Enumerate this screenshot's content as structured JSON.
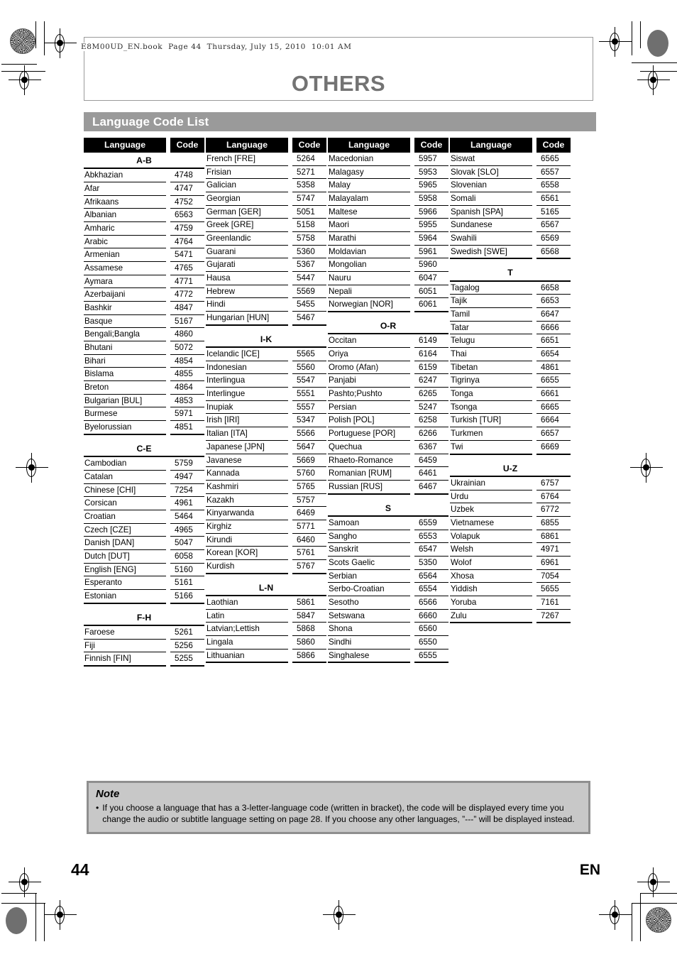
{
  "page": {
    "book_header": "E8M00UD_EN.book  Page 44  Thursday, July 15, 2010  10:01 AM",
    "chapter_title": "OTHERS",
    "section_title": "Language Code List",
    "page_number": "44",
    "page_language": "EN"
  },
  "table": {
    "header_language": "Language",
    "header_code": "Code"
  },
  "columns": [
    {
      "groups": [
        {
          "label": "A-B",
          "rows": [
            {
              "language": "Abkhazian",
              "code": "4748"
            },
            {
              "language": "Afar",
              "code": "4747"
            },
            {
              "language": "Afrikaans",
              "code": "4752"
            },
            {
              "language": "Albanian",
              "code": "6563"
            },
            {
              "language": "Amharic",
              "code": "4759"
            },
            {
              "language": "Arabic",
              "code": "4764"
            },
            {
              "language": "Armenian",
              "code": "5471"
            },
            {
              "language": "Assamese",
              "code": "4765"
            },
            {
              "language": "Aymara",
              "code": "4771"
            },
            {
              "language": "Azerbaijani",
              "code": "4772"
            },
            {
              "language": "Bashkir",
              "code": "4847"
            },
            {
              "language": "Basque",
              "code": "5167"
            },
            {
              "language": "Bengali;Bangla",
              "code": "4860"
            },
            {
              "language": "Bhutani",
              "code": "5072"
            },
            {
              "language": "Bihari",
              "code": "4854"
            },
            {
              "language": "Bislama",
              "code": "4855"
            },
            {
              "language": "Breton",
              "code": "4864"
            },
            {
              "language": "Bulgarian [BUL]",
              "code": "4853"
            },
            {
              "language": "Burmese",
              "code": "5971"
            },
            {
              "language": "Byelorussian",
              "code": "4851"
            }
          ]
        },
        {
          "label": "C-E",
          "rows": [
            {
              "language": "Cambodian",
              "code": "5759"
            },
            {
              "language": "Catalan",
              "code": "4947"
            },
            {
              "language": "Chinese [CHI]",
              "code": "7254"
            },
            {
              "language": "Corsican",
              "code": "4961"
            },
            {
              "language": "Croatian",
              "code": "5464"
            },
            {
              "language": "Czech [CZE]",
              "code": "4965"
            },
            {
              "language": "Danish [DAN]",
              "code": "5047"
            },
            {
              "language": "Dutch [DUT]",
              "code": "6058"
            },
            {
              "language": "English [ENG]",
              "code": "5160"
            },
            {
              "language": "Esperanto",
              "code": "5161"
            },
            {
              "language": "Estonian",
              "code": "5166"
            }
          ]
        },
        {
          "label": "F-H",
          "rows": [
            {
              "language": "Faroese",
              "code": "5261"
            },
            {
              "language": "Fiji",
              "code": "5256"
            },
            {
              "language": "Finnish [FIN]",
              "code": "5255"
            }
          ]
        }
      ]
    },
    {
      "groups": [
        {
          "label": "",
          "rows": [
            {
              "language": "French [FRE]",
              "code": "5264"
            },
            {
              "language": "Frisian",
              "code": "5271"
            },
            {
              "language": "Galician",
              "code": "5358"
            },
            {
              "language": "Georgian",
              "code": "5747"
            },
            {
              "language": "German [GER]",
              "code": "5051"
            },
            {
              "language": "Greek [GRE]",
              "code": "5158"
            },
            {
              "language": "Greenlandic",
              "code": "5758"
            },
            {
              "language": "Guarani",
              "code": "5360"
            },
            {
              "language": "Gujarati",
              "code": "5367"
            },
            {
              "language": "Hausa",
              "code": "5447"
            },
            {
              "language": "Hebrew",
              "code": "5569"
            },
            {
              "language": "Hindi",
              "code": "5455"
            },
            {
              "language": "Hungarian [HUN]",
              "code": "5467"
            }
          ]
        },
        {
          "label": "I-K",
          "rows": [
            {
              "language": "Icelandic [ICE]",
              "code": "5565"
            },
            {
              "language": "Indonesian",
              "code": "5560"
            },
            {
              "language": "Interlingua",
              "code": "5547"
            },
            {
              "language": "Interlingue",
              "code": "5551"
            },
            {
              "language": "Inupiak",
              "code": "5557"
            },
            {
              "language": "Irish [IRI]",
              "code": "5347"
            },
            {
              "language": "Italian [ITA]",
              "code": "5566"
            },
            {
              "language": "Japanese [JPN]",
              "code": "5647"
            },
            {
              "language": "Javanese",
              "code": "5669"
            },
            {
              "language": "Kannada",
              "code": "5760"
            },
            {
              "language": "Kashmiri",
              "code": "5765"
            },
            {
              "language": "Kazakh",
              "code": "5757"
            },
            {
              "language": "Kinyarwanda",
              "code": "6469"
            },
            {
              "language": "Kirghiz",
              "code": "5771"
            },
            {
              "language": "Kirundi",
              "code": "6460"
            },
            {
              "language": "Korean [KOR]",
              "code": "5761"
            },
            {
              "language": "Kurdish",
              "code": "5767"
            }
          ]
        },
        {
          "label": "L-N",
          "rows": [
            {
              "language": "Laothian",
              "code": "5861"
            },
            {
              "language": "Latin",
              "code": "5847"
            },
            {
              "language": "Latvian;Lettish",
              "code": "5868"
            },
            {
              "language": "Lingala",
              "code": "5860"
            },
            {
              "language": "Lithuanian",
              "code": "5866"
            }
          ]
        }
      ]
    },
    {
      "groups": [
        {
          "label": "",
          "rows": [
            {
              "language": "Macedonian",
              "code": "5957"
            },
            {
              "language": "Malagasy",
              "code": "5953"
            },
            {
              "language": "Malay",
              "code": "5965"
            },
            {
              "language": "Malayalam",
              "code": "5958"
            },
            {
              "language": "Maltese",
              "code": "5966"
            },
            {
              "language": "Maori",
              "code": "5955"
            },
            {
              "language": "Marathi",
              "code": "5964"
            },
            {
              "language": "Moldavian",
              "code": "5961"
            },
            {
              "language": "Mongolian",
              "code": "5960"
            },
            {
              "language": "Nauru",
              "code": "6047"
            },
            {
              "language": "Nepali",
              "code": "6051"
            },
            {
              "language": "Norwegian [NOR]",
              "code": "6061"
            }
          ]
        },
        {
          "label": "O-R",
          "rows": [
            {
              "language": "Occitan",
              "code": "6149"
            },
            {
              "language": "Oriya",
              "code": "6164"
            },
            {
              "language": "Oromo (Afan)",
              "code": "6159"
            },
            {
              "language": "Panjabi",
              "code": "6247"
            },
            {
              "language": "Pashto;Pushto",
              "code": "6265"
            },
            {
              "language": "Persian",
              "code": "5247"
            },
            {
              "language": "Polish [POL]",
              "code": "6258"
            },
            {
              "language": "Portuguese [POR]",
              "code": "6266"
            },
            {
              "language": "Quechua",
              "code": "6367"
            },
            {
              "language": "Rhaeto-Romance",
              "code": "6459"
            },
            {
              "language": "Romanian [RUM]",
              "code": "6461"
            },
            {
              "language": "Russian [RUS]",
              "code": "6467"
            }
          ]
        },
        {
          "label": "S",
          "rows": [
            {
              "language": "Samoan",
              "code": "6559"
            },
            {
              "language": "Sangho",
              "code": "6553"
            },
            {
              "language": "Sanskrit",
              "code": "6547"
            },
            {
              "language": "Scots Gaelic",
              "code": "5350"
            },
            {
              "language": "Serbian",
              "code": "6564"
            },
            {
              "language": "Serbo-Croatian",
              "code": "6554"
            },
            {
              "language": "Sesotho",
              "code": "6566"
            },
            {
              "language": "Setswana",
              "code": "6660"
            },
            {
              "language": "Shona",
              "code": "6560"
            },
            {
              "language": "Sindhi",
              "code": "6550"
            },
            {
              "language": "Singhalese",
              "code": "6555"
            }
          ]
        }
      ]
    },
    {
      "groups": [
        {
          "label": "",
          "rows": [
            {
              "language": "Siswat",
              "code": "6565"
            },
            {
              "language": "Slovak [SLO]",
              "code": "6557"
            },
            {
              "language": "Slovenian",
              "code": "6558"
            },
            {
              "language": "Somali",
              "code": "6561"
            },
            {
              "language": "Spanish [SPA]",
              "code": "5165"
            },
            {
              "language": "Sundanese",
              "code": "6567"
            },
            {
              "language": "Swahili",
              "code": "6569"
            },
            {
              "language": "Swedish [SWE]",
              "code": "6568"
            }
          ]
        },
        {
          "label": "T",
          "rows": [
            {
              "language": "Tagalog",
              "code": "6658"
            },
            {
              "language": "Tajik",
              "code": "6653"
            },
            {
              "language": "Tamil",
              "code": "6647"
            },
            {
              "language": "Tatar",
              "code": "6666"
            },
            {
              "language": "Telugu",
              "code": "6651"
            },
            {
              "language": "Thai",
              "code": "6654"
            },
            {
              "language": "Tibetan",
              "code": "4861"
            },
            {
              "language": "Tigrinya",
              "code": "6655"
            },
            {
              "language": "Tonga",
              "code": "6661"
            },
            {
              "language": "Tsonga",
              "code": "6665"
            },
            {
              "language": "Turkish [TUR]",
              "code": "6664"
            },
            {
              "language": "Turkmen",
              "code": "6657"
            },
            {
              "language": "Twi",
              "code": "6669"
            }
          ]
        },
        {
          "label": "U-Z",
          "rows": [
            {
              "language": "Ukrainian",
              "code": "6757"
            },
            {
              "language": "Urdu",
              "code": "6764"
            },
            {
              "language": "Uzbek",
              "code": "6772"
            },
            {
              "language": "Vietnamese",
              "code": "6855"
            },
            {
              "language": "Volapuk",
              "code": "6861"
            },
            {
              "language": "Welsh",
              "code": "4971"
            },
            {
              "language": "Wolof",
              "code": "6961"
            },
            {
              "language": "Xhosa",
              "code": "7054"
            },
            {
              "language": "Yiddish",
              "code": "5655"
            },
            {
              "language": "Yoruba",
              "code": "7161"
            },
            {
              "language": "Zulu",
              "code": "7267"
            }
          ]
        }
      ]
    }
  ],
  "note": {
    "title": "Note",
    "bullet": "•",
    "text": "If you choose a language that has a 3-letter-language code (written in bracket), the code will be displayed every time you change the audio or subtitle language setting on page 28. If you choose any other languages, ”---” will be displayed instead."
  }
}
